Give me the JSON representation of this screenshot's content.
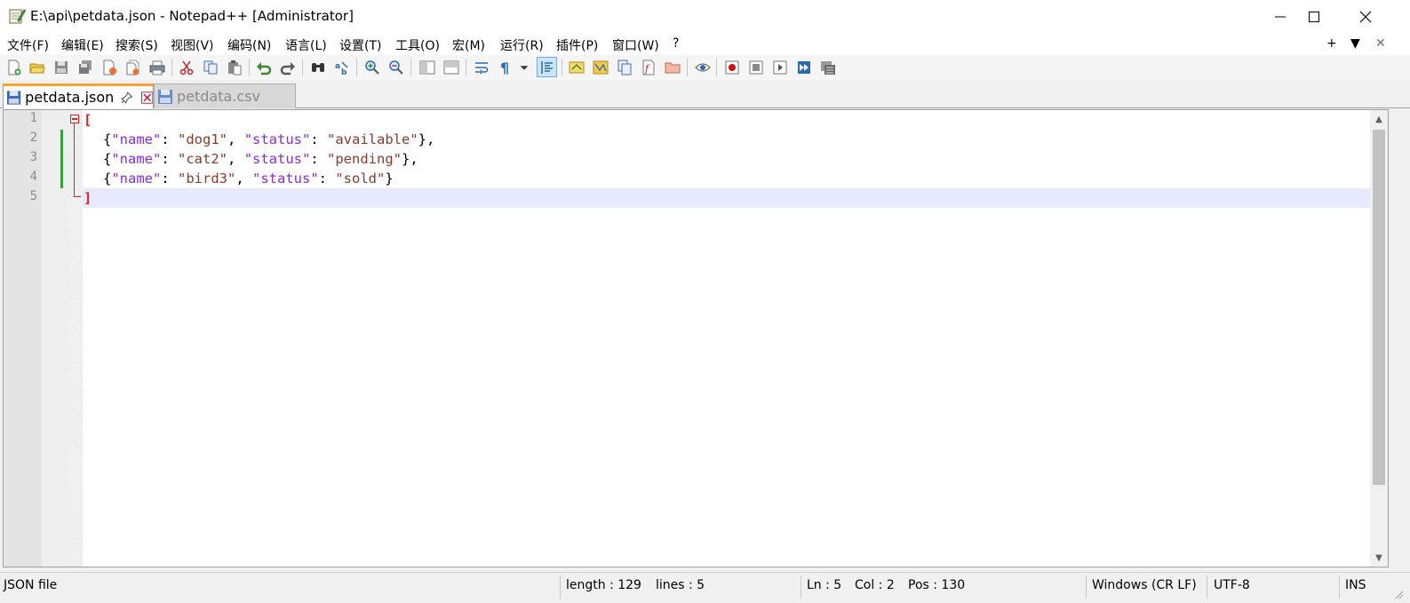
{
  "window": {
    "title": "E:\\api\\petdata.json - Notepad++ [Administrator]",
    "icons": [
      "notepad-app-icon",
      "minimize-icon",
      "maximize-icon",
      "close-icon"
    ]
  },
  "menu": {
    "items": [
      "文件(F)",
      "编辑(E)",
      "搜索(S)",
      "视图(V)",
      "编码(N)",
      "语言(L)",
      "设置(T)",
      "工具(O)",
      "宏(M)",
      "运行(R)",
      "插件(P)",
      "窗口(W)",
      "?"
    ],
    "right": [
      "+",
      "▼",
      "✕"
    ]
  },
  "toolbar": {
    "icons": [
      "new-file-icon",
      "open-file-icon",
      "save-icon",
      "save-all-icon",
      "close-icon",
      "close-all-icon",
      "print-icon",
      "cut-icon",
      "copy-icon",
      "paste-icon",
      "undo-icon",
      "redo-icon",
      "find-icon",
      "replace-icon",
      "zoom-in-icon",
      "zoom-out-icon",
      "sync-vertical-icon",
      "sync-horizontal-icon",
      "word-wrap-icon",
      "show-all-chars-icon",
      "indent-guide-icon",
      "doc-map-icon",
      "function-list-icon",
      "folder-workspace-icon",
      "monitoring-icon",
      "eye-icon",
      "record-macro-icon",
      "stop-macro-icon",
      "play-macro-icon",
      "run-macro-multiple-icon",
      "save-macro-icon"
    ]
  },
  "tabs": [
    {
      "label": "petdata.json",
      "active": true
    },
    {
      "label": "petdata.csv",
      "active": false
    }
  ],
  "editor": {
    "line_numbers": [
      "1",
      "2",
      "3",
      "4",
      "5"
    ],
    "lines": [
      {
        "bracket": "["
      },
      {
        "brace_open": "{",
        "key1": "\"name\"",
        "sep1": ": ",
        "val1": "\"dog1\"",
        "comma1": ", ",
        "key2": "\"status\"",
        "sep2": ": ",
        "val2": "\"available\"",
        "brace_close": "},"
      },
      {
        "brace_open": "{",
        "key1": "\"name\"",
        "sep1": ": ",
        "val1": "\"cat2\"",
        "comma1": ", ",
        "key2": "\"status\"",
        "sep2": ": ",
        "val2": "\"pending\"",
        "brace_close": "},"
      },
      {
        "brace_open": "{",
        "key1": "\"name\"",
        "sep1": ": ",
        "val1": "\"bird3\"",
        "comma1": ", ",
        "key2": "\"status\"",
        "sep2": ": ",
        "val2": "\"sold\"",
        "brace_close": "}"
      },
      {
        "bracket": "]"
      }
    ]
  },
  "status": {
    "file_type": "JSON file",
    "length": "length : 129",
    "lines": "lines : 5",
    "ln": "Ln : 5",
    "col": "Col : 2",
    "pos": "Pos : 130",
    "eol": "Windows (CR LF)",
    "encoding": "UTF-8",
    "mode": "INS"
  },
  "colors": {
    "active_tab_accent": "#f7a330",
    "json_key": "#8a2be2",
    "json_string": "#8b3a2a",
    "bracket": "#e02020",
    "change_marker": "#3aa23a",
    "current_line": "#e8e8ff"
  }
}
